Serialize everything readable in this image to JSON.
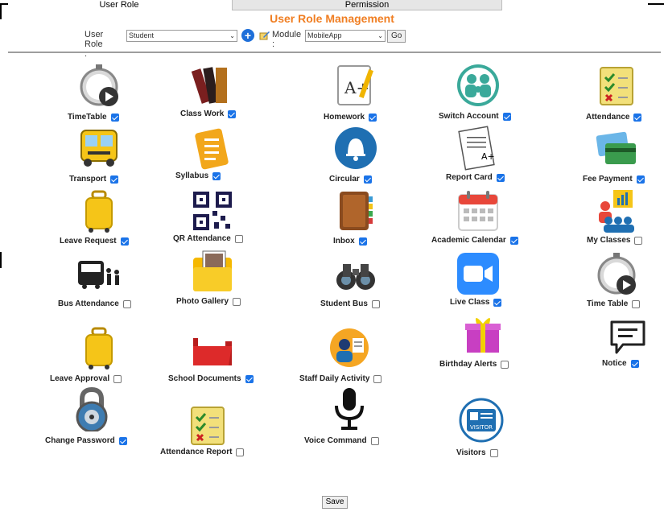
{
  "tabs": [
    "User Role",
    "Permission"
  ],
  "title": "User Role Management",
  "toolbar": {
    "role_label": "User Role :",
    "role_value": "Student",
    "module_label": "Module :",
    "module_value": "MobileApp",
    "go": "Go"
  },
  "save": "Save",
  "colors": {
    "title": "#f07e22",
    "checkbox": "#1a73e8"
  },
  "items": [
    {
      "label": "TimeTable",
      "checked": true,
      "icon": "stopwatch-icon"
    },
    {
      "label": "Class Work",
      "checked": true,
      "icon": "books-icon"
    },
    {
      "label": "Homework",
      "checked": true,
      "icon": "homework-icon"
    },
    {
      "label": "Switch Account",
      "checked": true,
      "icon": "family-icon"
    },
    {
      "label": "Attendance",
      "checked": true,
      "icon": "checklist-icon"
    },
    {
      "label": "Transport",
      "checked": true,
      "icon": "bus-icon"
    },
    {
      "label": "Syllabus",
      "checked": true,
      "icon": "syllabus-icon"
    },
    {
      "label": "Circular",
      "checked": true,
      "icon": "bell-icon"
    },
    {
      "label": "Report Card",
      "checked": true,
      "icon": "report-card-icon"
    },
    {
      "label": "Fee Payment",
      "checked": true,
      "icon": "credit-card-icon"
    },
    {
      "label": "Leave Request",
      "checked": true,
      "icon": "luggage-icon"
    },
    {
      "label": "QR Attendance",
      "checked": false,
      "icon": "qr-code-icon"
    },
    {
      "label": "Inbox",
      "checked": true,
      "icon": "address-book-icon"
    },
    {
      "label": "Academic Calendar",
      "checked": true,
      "icon": "calendar-icon"
    },
    {
      "label": "My Classes",
      "checked": false,
      "icon": "classroom-icon"
    },
    {
      "label": "Bus Attendance",
      "checked": false,
      "icon": "bus-attendance-icon"
    },
    {
      "label": "Photo Gallery",
      "checked": false,
      "icon": "folder-photo-icon"
    },
    {
      "label": "Student Bus",
      "checked": false,
      "icon": "binoculars-icon"
    },
    {
      "label": "Live Class",
      "checked": true,
      "icon": "video-camera-icon"
    },
    {
      "label": "Time Table",
      "checked": false,
      "icon": "stopwatch-icon"
    },
    {
      "label": "Leave Approval",
      "checked": false,
      "icon": "luggage-icon"
    },
    {
      "label": "School Documents",
      "checked": true,
      "icon": "red-folder-icon"
    },
    {
      "label": "Staff Daily Activity",
      "checked": false,
      "icon": "staff-activity-icon"
    },
    {
      "label": "Birthday Alerts",
      "checked": false,
      "icon": "gift-icon"
    },
    {
      "label": "Notice",
      "checked": true,
      "icon": "speech-bubble-icon"
    },
    {
      "label": "Change Password",
      "checked": true,
      "icon": "padlock-icon"
    },
    {
      "label": "Attendance Report",
      "checked": false,
      "icon": "checklist-icon"
    },
    {
      "label": "Voice Command",
      "checked": false,
      "icon": "microphone-icon"
    },
    {
      "label": "Visitors",
      "checked": false,
      "icon": "visitor-badge-icon"
    }
  ]
}
